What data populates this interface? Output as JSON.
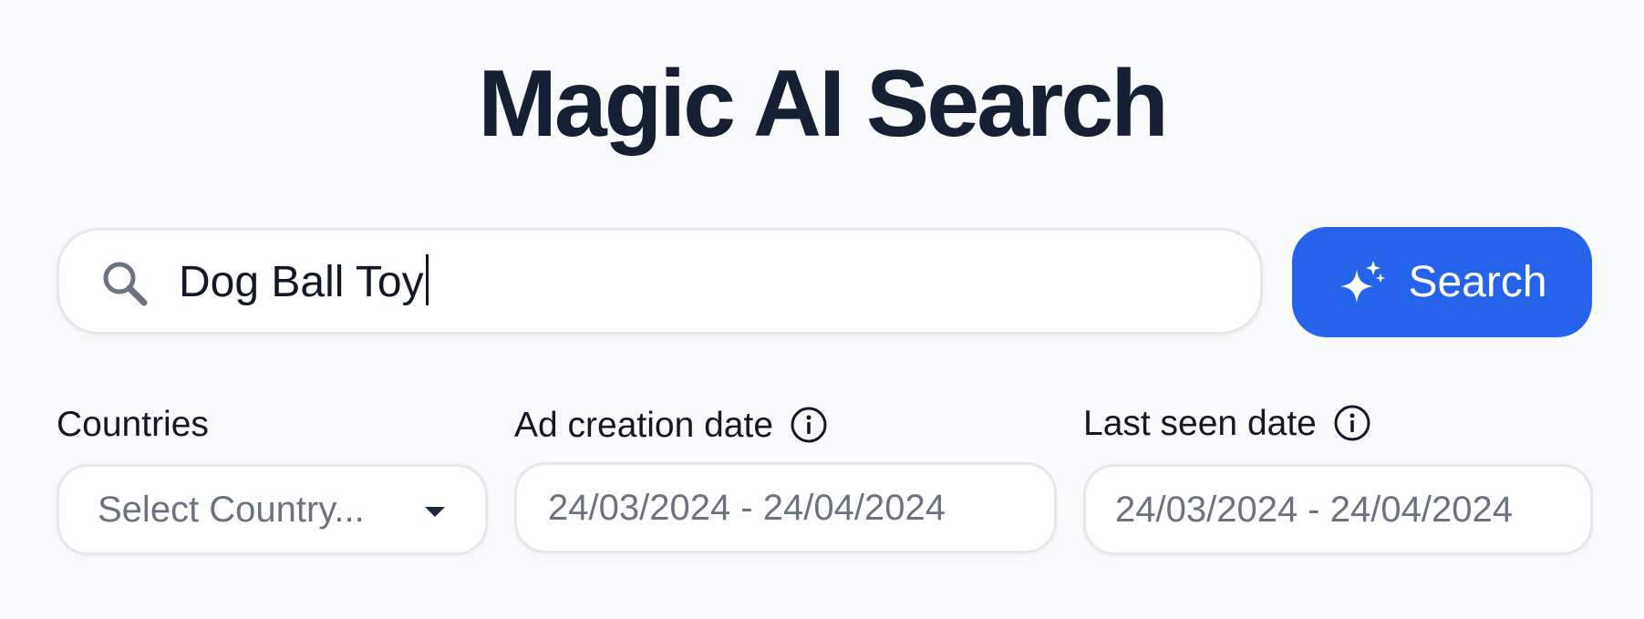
{
  "header": {
    "title": "Magic AI Search"
  },
  "search": {
    "icon": "search-icon",
    "value": "Dog Ball Toy",
    "button_label": "Search",
    "button_icon": "sparkle-icon",
    "button_color": "#2563eb"
  },
  "filters": {
    "countries": {
      "label": "Countries",
      "placeholder": "Select Country..."
    },
    "ad_creation_date": {
      "label": "Ad creation date",
      "value": "24/03/2024 - 24/04/2024",
      "info_icon": "info-icon"
    },
    "last_seen_date": {
      "label": "Last seen date",
      "value": "24/03/2024 - 24/04/2024",
      "info_icon": "info-icon"
    }
  }
}
